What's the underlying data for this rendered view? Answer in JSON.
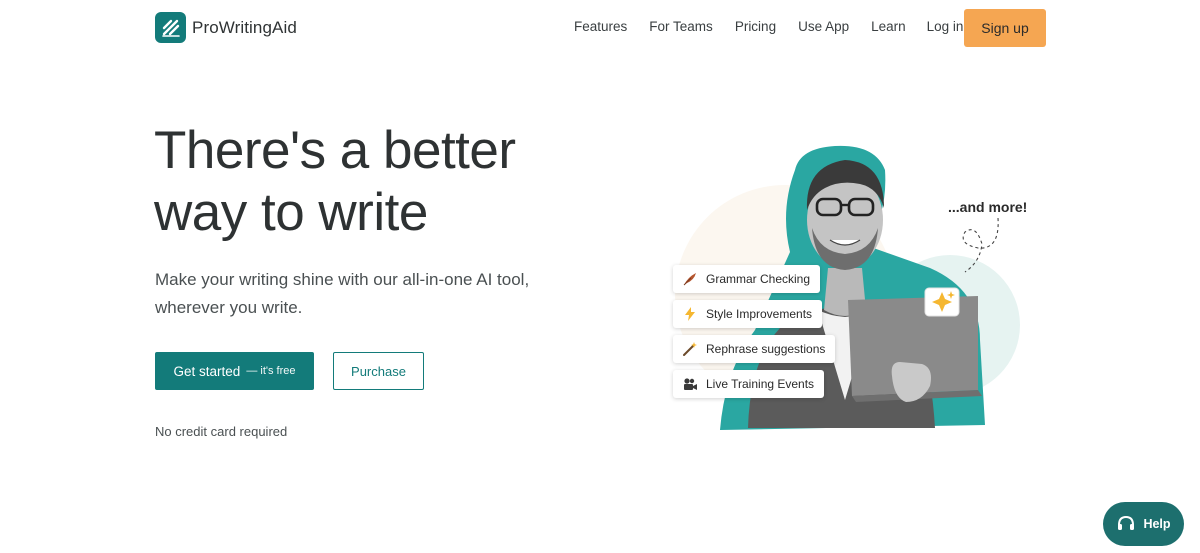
{
  "brand": {
    "name": "ProWritingAid",
    "color": "#137b7a"
  },
  "nav": {
    "items": [
      "Features",
      "For Teams",
      "Pricing",
      "Use App",
      "Learn",
      "Log in"
    ],
    "signup_label": "Sign up",
    "signup_color": "#f5a652"
  },
  "hero": {
    "title_line1": "There's a better",
    "title_line2": "way to write",
    "subtitle_line1": "Make your writing shine with our all-in-one AI tool,",
    "subtitle_line2": "wherever you write.",
    "primary_label": "Get started",
    "primary_suffix": "— it's free",
    "secondary_label": "Purchase",
    "note": "No credit card required"
  },
  "illustration": {
    "features": [
      {
        "label": "Grammar Checking",
        "icon": "quill-icon"
      },
      {
        "label": "Style Improvements",
        "icon": "lightning-icon"
      },
      {
        "label": "Rephrase suggestions",
        "icon": "magic-wand-icon"
      },
      {
        "label": "Live Training Events",
        "icon": "video-camera-icon"
      }
    ],
    "and_more": "...and more!",
    "sparkle_icon": "sparkle-icon"
  },
  "help": {
    "label": "Help",
    "color": "#1d6f6e"
  }
}
